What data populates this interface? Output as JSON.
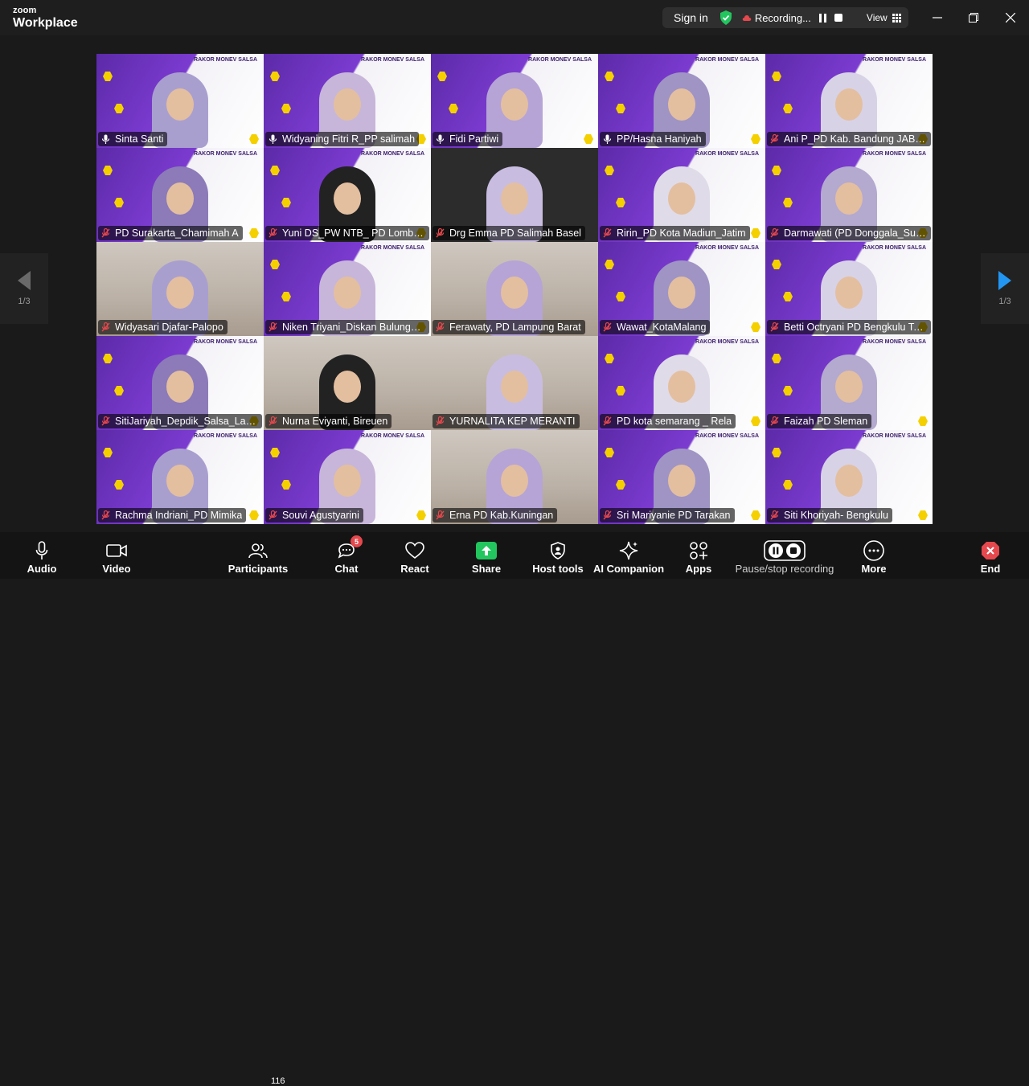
{
  "app": {
    "brand_top": "zoom",
    "brand_bottom": "Workplace"
  },
  "header": {
    "signin": "Sign in",
    "recording": "Recording...",
    "view": "View"
  },
  "pager": {
    "left": "1/3",
    "right": "1/3"
  },
  "tiles": [
    {
      "name": "Sinta Santi",
      "type": "slide",
      "muted": false,
      "active": true
    },
    {
      "name": "Widyaning Fitri R_PP salimah",
      "type": "slide",
      "muted": false
    },
    {
      "name": "Fidi Partiwi",
      "type": "slide",
      "muted": false
    },
    {
      "name": "PP/Hasna Haniyah",
      "type": "slide",
      "muted": false
    },
    {
      "name": "Ani P_PD Kab. Bandung JABAR",
      "type": "slide",
      "muted": true
    },
    {
      "name": "PD Surakarta_Chamimah A",
      "type": "slide",
      "muted": true
    },
    {
      "name": "Yuni DS_PW NTB_ PD Lombok...",
      "type": "slide",
      "muted": true
    },
    {
      "name": "Drg Emma PD Salimah Basel",
      "type": "dark",
      "muted": true
    },
    {
      "name": "Ririn_PD Kota Madiun_Jatim",
      "type": "slide",
      "muted": true
    },
    {
      "name": "Darmawati (PD Donggala_Sulte...",
      "type": "slide",
      "muted": true
    },
    {
      "name": "Widyasari Djafar-Palopo",
      "type": "room",
      "muted": true
    },
    {
      "name": "Niken Triyani_Diskan Bulungan...",
      "type": "slide",
      "muted": true
    },
    {
      "name": "Ferawaty, PD Lampung Barat",
      "type": "room",
      "muted": true
    },
    {
      "name": "Wawat_KotaMalang",
      "type": "slide",
      "muted": true
    },
    {
      "name": "Betti Octryani PD Bengkulu Ten...",
      "type": "slide",
      "muted": true
    },
    {
      "name": "SitiJariyah_Depdik_Salsa_Lamp...",
      "type": "slide",
      "muted": true
    },
    {
      "name": "Nurna Eviyanti, Bireuen",
      "type": "room",
      "muted": true
    },
    {
      "name": "YURNALITA KEP MERANTI",
      "type": "room",
      "muted": true
    },
    {
      "name": "PD kota semarang _ Rela",
      "type": "slide",
      "muted": true
    },
    {
      "name": "Faizah PD Sleman",
      "type": "slide",
      "muted": true
    },
    {
      "name": "Rachma Indriani_PD Mimika",
      "type": "slide",
      "muted": true
    },
    {
      "name": "Souvi Agustyarini",
      "type": "slide",
      "muted": true
    },
    {
      "name": "Erna PD Kab.Kuningan",
      "type": "room",
      "muted": true
    },
    {
      "name": "Sri Mariyanie PD Tarakan",
      "type": "slide",
      "muted": true
    },
    {
      "name": "Siti Khoriyah- Bengkulu",
      "type": "slide",
      "muted": true
    }
  ],
  "slide_header": "RAKOR MONEV SALSA",
  "toolbar": {
    "audio": "Audio",
    "video": "Video",
    "participants": "Participants",
    "participants_count": "116",
    "chat": "Chat",
    "chat_badge": "5",
    "react": "React",
    "share": "Share",
    "host_tools": "Host tools",
    "ai_companion": "AI Companion",
    "apps": "Apps",
    "pause_stop": "Pause/stop recording",
    "more": "More",
    "end": "End"
  },
  "colors": {
    "accent_green": "#3ecf8e",
    "share_green": "#22c55e",
    "end_red": "#e5484d",
    "muted_red": "#e5484d"
  }
}
